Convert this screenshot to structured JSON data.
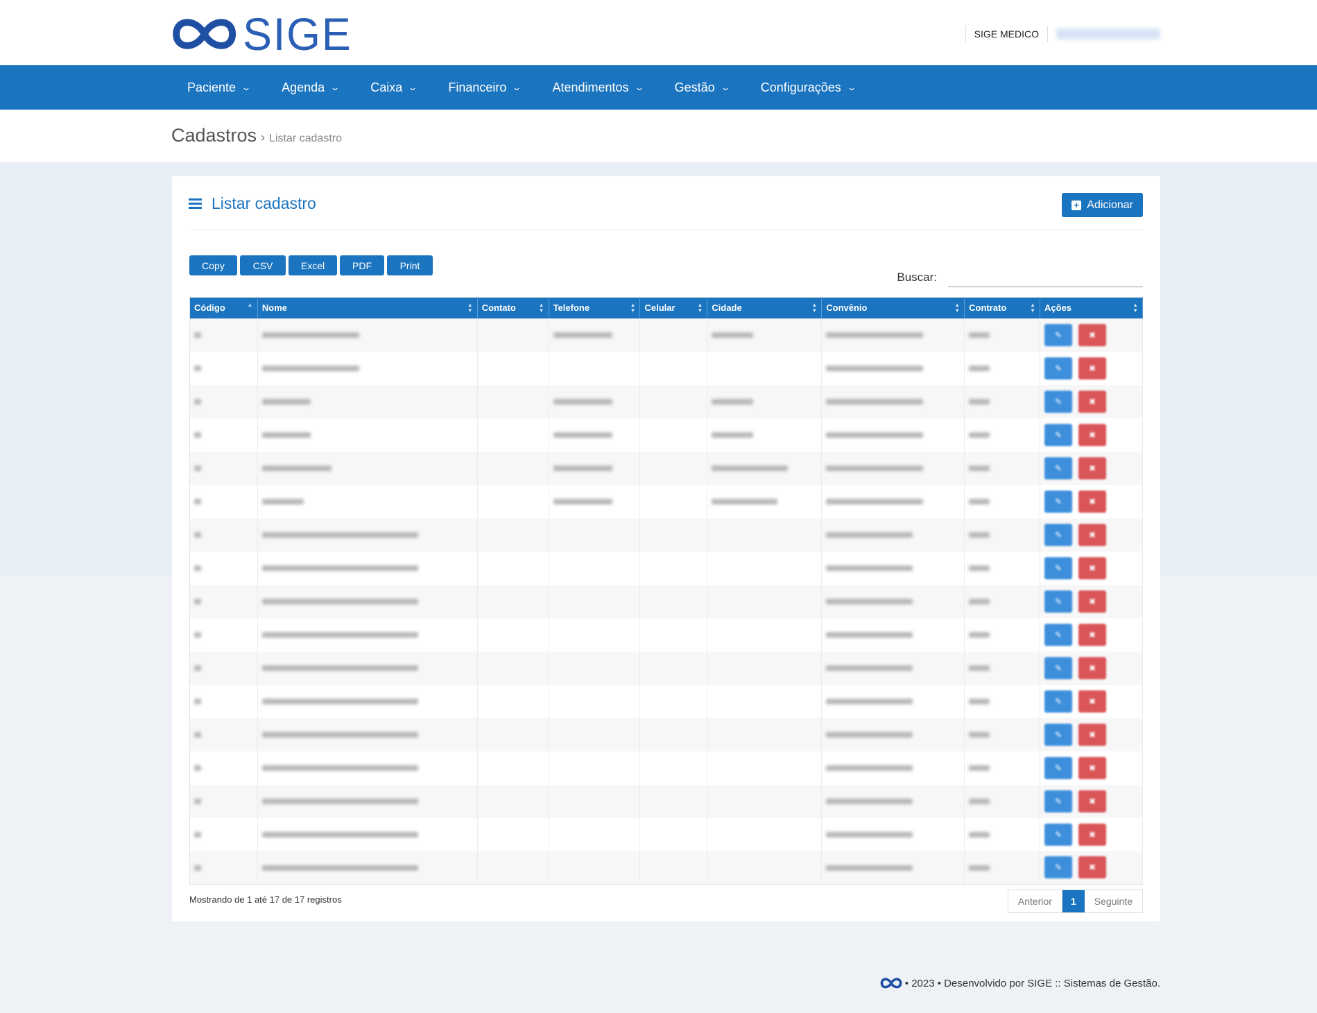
{
  "brand": {
    "name": "SIGE"
  },
  "header": {
    "account_label": "SIGE MEDICO"
  },
  "nav": [
    {
      "label": "Paciente"
    },
    {
      "label": "Agenda"
    },
    {
      "label": "Caixa"
    },
    {
      "label": "Financeiro"
    },
    {
      "label": "Atendimentos"
    },
    {
      "label": "Gestão"
    },
    {
      "label": "Configurações"
    }
  ],
  "breadcrumb": {
    "main": "Cadastros",
    "separator": "›",
    "current": "Listar cadastro"
  },
  "card": {
    "title": "Listar cadastro",
    "add_button": "Adicionar"
  },
  "export_buttons": [
    "Copy",
    "CSV",
    "Excel",
    "PDF",
    "Print"
  ],
  "search": {
    "label": "Buscar:",
    "value": ""
  },
  "table": {
    "columns": [
      "Código",
      "Nome",
      "Contato",
      "Telefone",
      "Celular",
      "Cidade",
      "Convênio",
      "Contrato",
      "Ações"
    ],
    "sorted_column": "Código",
    "row_count": 17,
    "cell_values_obscured": true
  },
  "pagination": {
    "info": "Mostrando de 1 até 17 de 17 registros",
    "prev": "Anterior",
    "current": "1",
    "next": "Seguinte"
  },
  "footer": {
    "text": "• 2023 • Desenvolvido por SIGE :: Sistemas de Gestão."
  },
  "colors": {
    "primary": "#1b74bf",
    "edit": "#3d8fdb",
    "delete": "#d95558",
    "background": "#eef2f7"
  }
}
